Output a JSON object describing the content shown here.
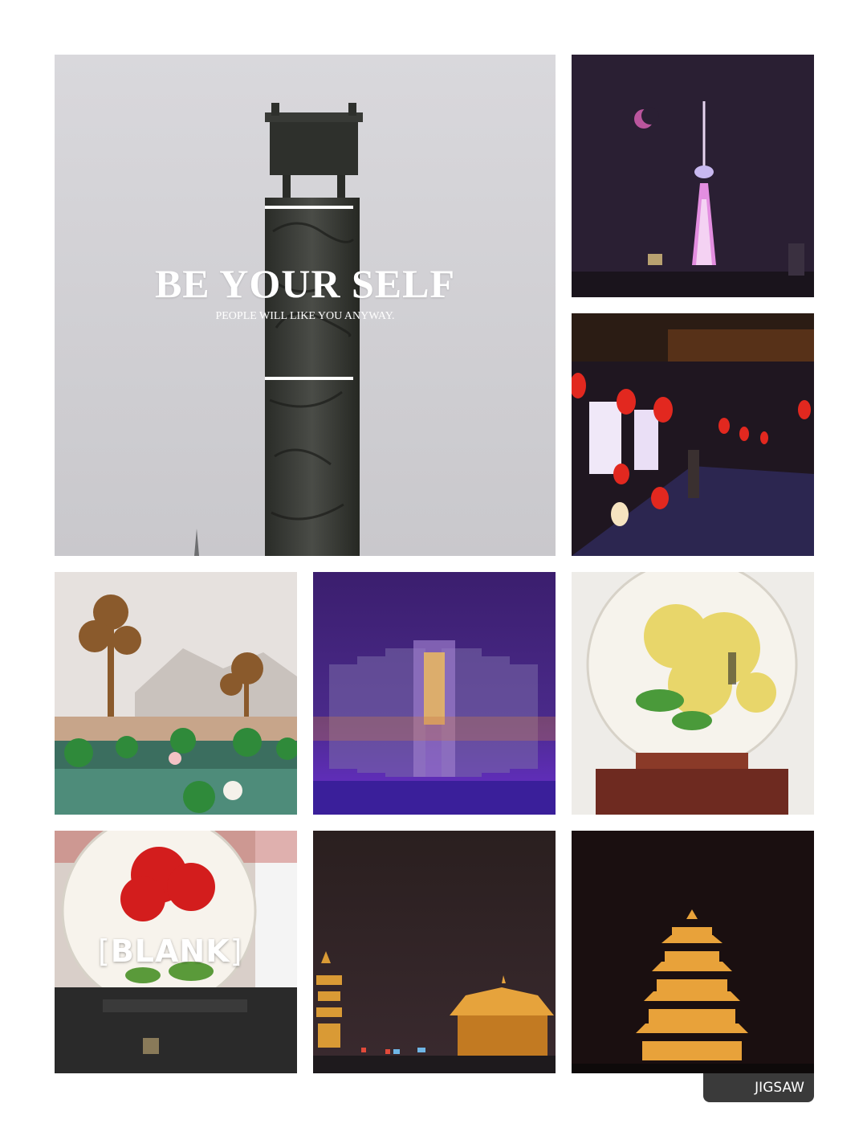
{
  "overlay": {
    "title": "BE YOUR SELF",
    "subtitle": "PEOPLE WILL LIKE YOU ANYWAY."
  },
  "label": {
    "open": "[",
    "text": "BLANK",
    "close": "]"
  },
  "badge": {
    "text": "JIGSAW"
  },
  "colors": {
    "background": "#ffffff",
    "badge": "#3a3a3a",
    "overlay_text": "#ffffff"
  }
}
